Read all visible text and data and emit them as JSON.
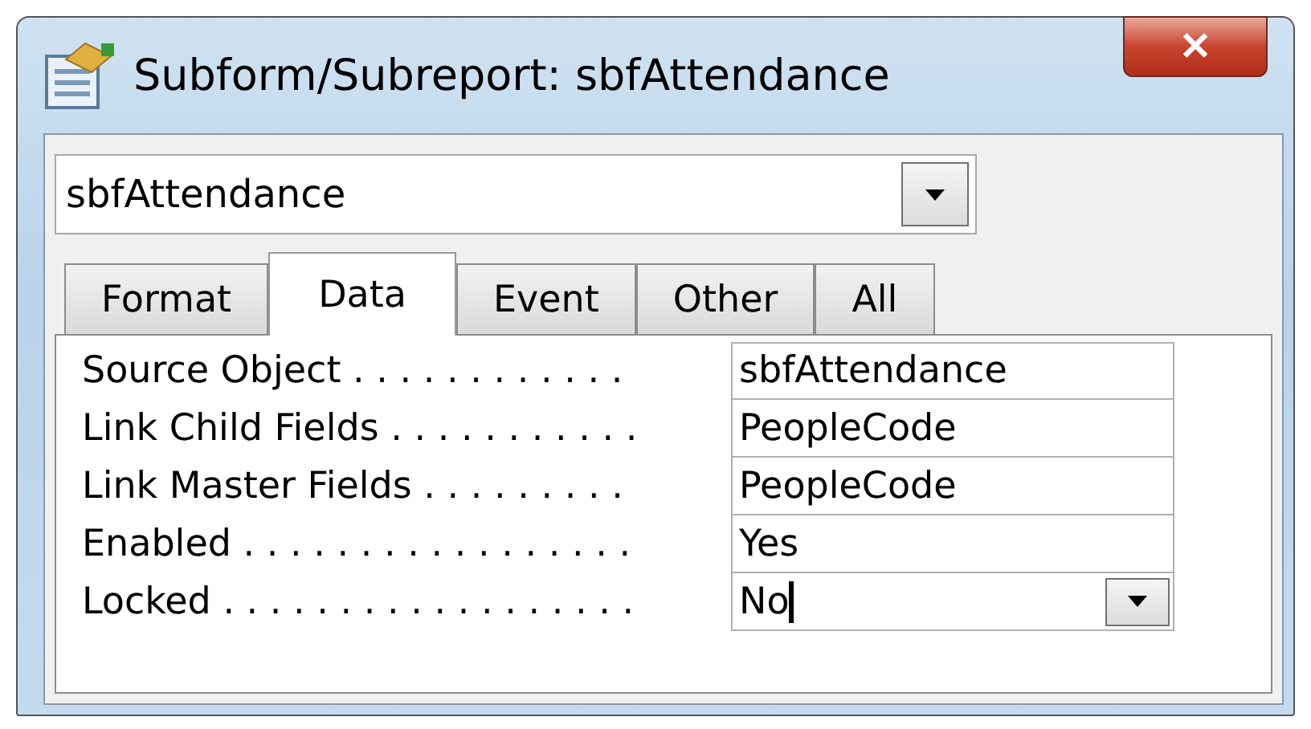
{
  "window": {
    "title": "Subform/Subreport: sbfAttendance",
    "close": "✕"
  },
  "object_selector": {
    "value": "sbfAttendance"
  },
  "tabs": [
    {
      "label": "Format",
      "selected": false
    },
    {
      "label": "Data",
      "selected": true
    },
    {
      "label": "Event",
      "selected": false
    },
    {
      "label": "Other",
      "selected": false
    },
    {
      "label": "All",
      "selected": false
    }
  ],
  "properties": [
    {
      "label": "Source Object . . . . . . . . . . . .",
      "value": "sbfAttendance",
      "kind": "text"
    },
    {
      "label": "Link Child Fields . . . . . . . . . . .",
      "value": "PeopleCode",
      "kind": "text"
    },
    {
      "label": "Link Master Fields . . . . . . . . .",
      "value": "PeopleCode",
      "kind": "text"
    },
    {
      "label": "Enabled . . . . . . . . . . . . . . . . .",
      "value": "Yes",
      "kind": "text"
    },
    {
      "label": "Locked . . . . . . . . . . . . . . . . . .",
      "value": "No",
      "kind": "dropdown"
    }
  ]
}
